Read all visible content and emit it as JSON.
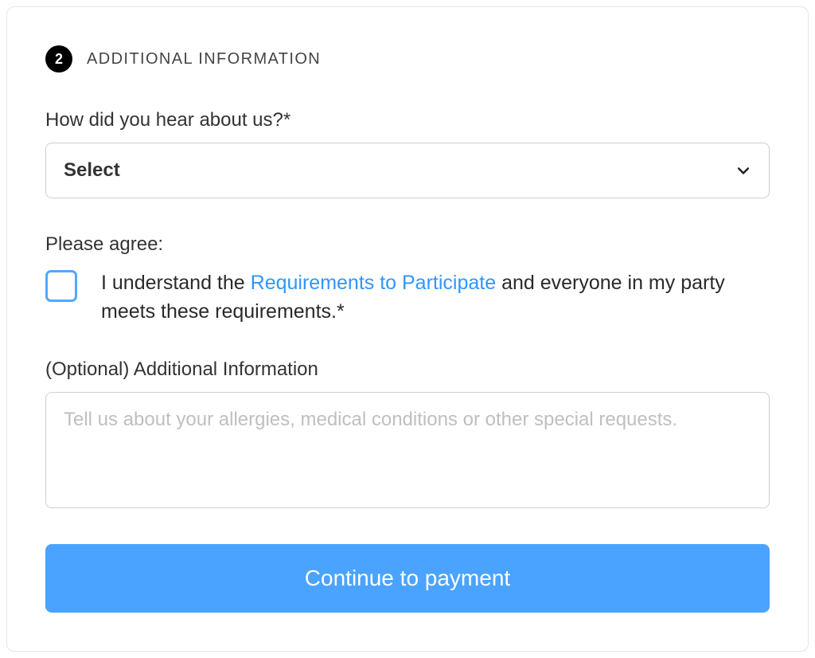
{
  "section": {
    "step_number": "2",
    "title": "ADDITIONAL INFORMATION"
  },
  "fields": {
    "hear_about": {
      "label": "How did you hear about us?*",
      "selected": "Select"
    },
    "agree": {
      "label": "Please agree:",
      "text_before": "I understand the ",
      "link_text": "Requirements to Participate",
      "text_after": " and everyone in my party meets these requirements.*"
    },
    "additional_info": {
      "label": "(Optional) Additional Information",
      "placeholder": "Tell us about your allergies, medical conditions or other special requests."
    }
  },
  "actions": {
    "continue_label": "Continue to payment"
  }
}
